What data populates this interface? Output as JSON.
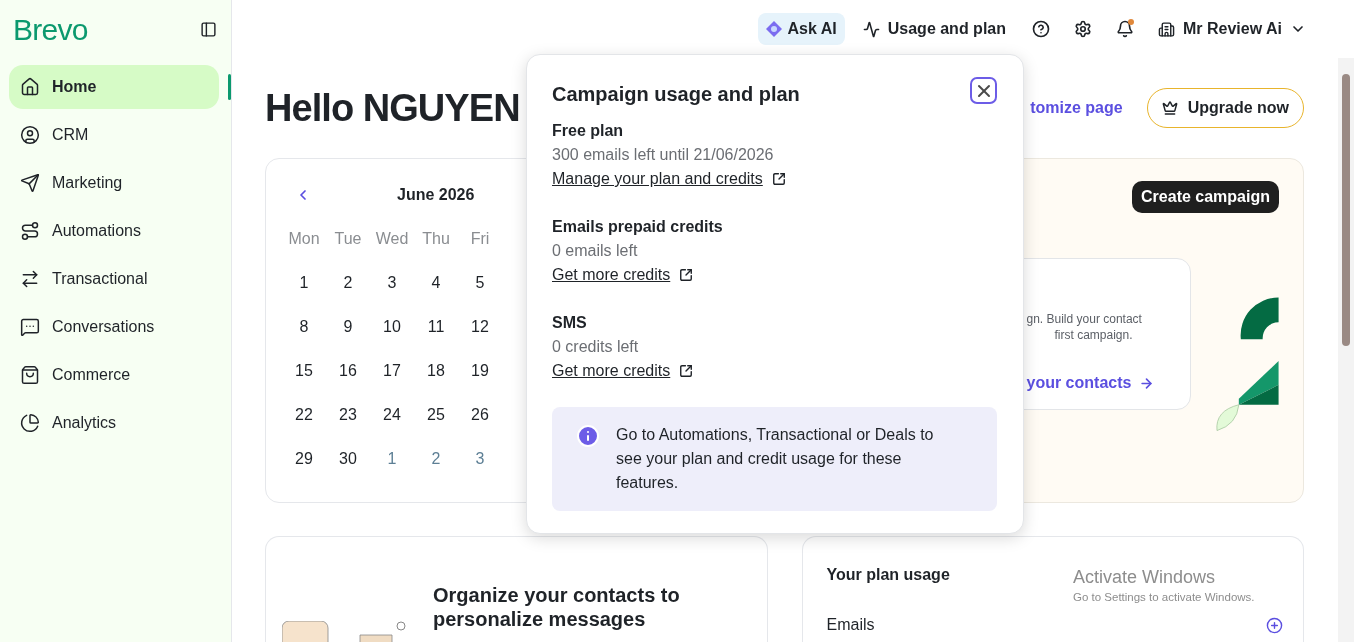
{
  "logo": "Brevo",
  "sidebar": {
    "items": [
      {
        "label": "Home",
        "selected": true
      },
      {
        "label": "CRM",
        "selected": false
      },
      {
        "label": "Marketing",
        "selected": false
      },
      {
        "label": "Automations",
        "selected": false
      },
      {
        "label": "Transactional",
        "selected": false
      },
      {
        "label": "Conversations",
        "selected": false
      },
      {
        "label": "Commerce",
        "selected": false
      },
      {
        "label": "Analytics",
        "selected": false
      }
    ]
  },
  "topbar": {
    "ask_ai": "Ask AI",
    "usage": "Usage and plan",
    "notification_dot": true,
    "account": "Mr Review Ai"
  },
  "header": {
    "greeting": "Hello NGUYEN",
    "customize_link": "tomize page",
    "upgrade_button": "Upgrade now"
  },
  "calendar": {
    "month": "June 2026",
    "weekdays": [
      "Mon",
      "Tue",
      "Wed",
      "Thu",
      "Fri"
    ],
    "weeks": [
      [
        {
          "day": "1",
          "muted": false
        },
        {
          "day": "2",
          "muted": false
        },
        {
          "day": "3",
          "muted": false
        },
        {
          "day": "4",
          "muted": false
        },
        {
          "day": "5",
          "muted": false
        }
      ],
      [
        {
          "day": "8",
          "muted": false
        },
        {
          "day": "9",
          "muted": false
        },
        {
          "day": "10",
          "muted": false
        },
        {
          "day": "11",
          "muted": false
        },
        {
          "day": "12",
          "muted": false
        }
      ],
      [
        {
          "day": "15",
          "muted": false
        },
        {
          "day": "16",
          "muted": false
        },
        {
          "day": "17",
          "muted": false
        },
        {
          "day": "18",
          "muted": false
        },
        {
          "day": "19",
          "muted": false
        }
      ],
      [
        {
          "day": "22",
          "muted": false
        },
        {
          "day": "23",
          "muted": false
        },
        {
          "day": "24",
          "muted": false
        },
        {
          "day": "25",
          "muted": false
        },
        {
          "day": "26",
          "muted": false
        }
      ],
      [
        {
          "day": "29",
          "muted": false
        },
        {
          "day": "30",
          "muted": false
        },
        {
          "day": "1",
          "muted": true
        },
        {
          "day": "2",
          "muted": true
        },
        {
          "day": "3",
          "muted": true
        }
      ]
    ]
  },
  "campaign_card": {
    "button": "Create campaign",
    "tip_lines": [
      "gn. Build your contact",
      "first campaign."
    ],
    "link": "your contacts"
  },
  "popover": {
    "title": "Campaign usage and plan",
    "sections": [
      {
        "title": "Free plan",
        "detail": "300 emails left until 21/06/2026",
        "link": "Manage your plan and credits"
      },
      {
        "title": "Emails prepaid credits",
        "detail": "0 emails left",
        "link": "Get more credits"
      },
      {
        "title": "SMS",
        "detail": "0 credits left",
        "link": "Get more credits"
      }
    ],
    "info": "Go to Automations, Transactional or Deals to see your plan and credit usage for these features."
  },
  "contacts_card": {
    "title": "Organize your contacts to personalize messages"
  },
  "plan_usage": {
    "title": "Your plan usage",
    "rows": [
      "Emails"
    ]
  },
  "os_notice": {
    "title": "Activate Windows",
    "subtitle": "Go to Settings to activate Windows."
  }
}
